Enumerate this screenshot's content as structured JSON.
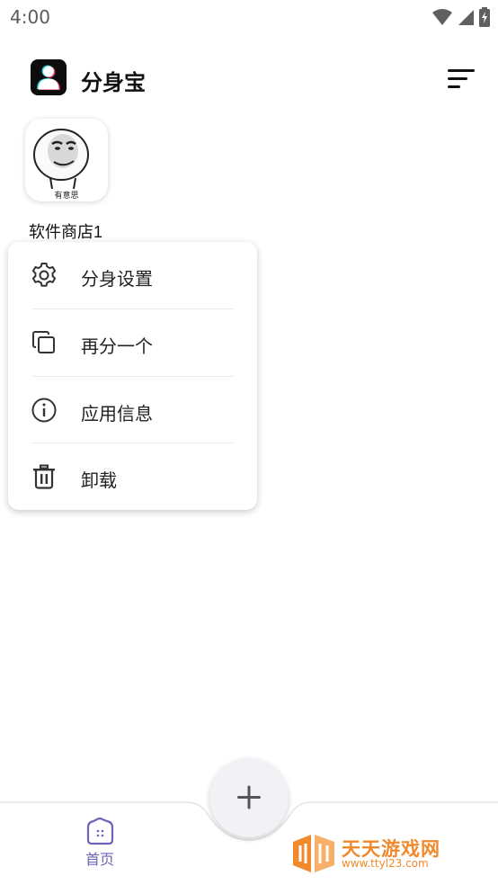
{
  "status_bar": {
    "time": "4:00",
    "icons": [
      "wifi-icon",
      "cell-signal-icon",
      "battery-charging-icon"
    ]
  },
  "app_bar": {
    "title": "分身宝",
    "logo_icon": "app-logo-icon",
    "sort_icon": "sort-icon"
  },
  "app_tile": {
    "name": "软件商店1",
    "icon_caption": "有意思"
  },
  "context_menu": {
    "items": [
      {
        "label": "分身设置",
        "icon": "gear-icon"
      },
      {
        "label": "再分一个",
        "icon": "copy-icon"
      },
      {
        "label": "应用信息",
        "icon": "info-icon"
      },
      {
        "label": "卸载",
        "icon": "trash-icon"
      }
    ]
  },
  "fab": {
    "icon": "plus-icon"
  },
  "bottom_nav": {
    "home_label": "首页",
    "home_icon": "home-icon"
  },
  "watermark": {
    "title": "天天游戏网",
    "url": "www.ttyl23.com"
  },
  "colors": {
    "accent": "#6b64b8",
    "watermark": "#f08a2c",
    "menu_icon": "#333333"
  }
}
